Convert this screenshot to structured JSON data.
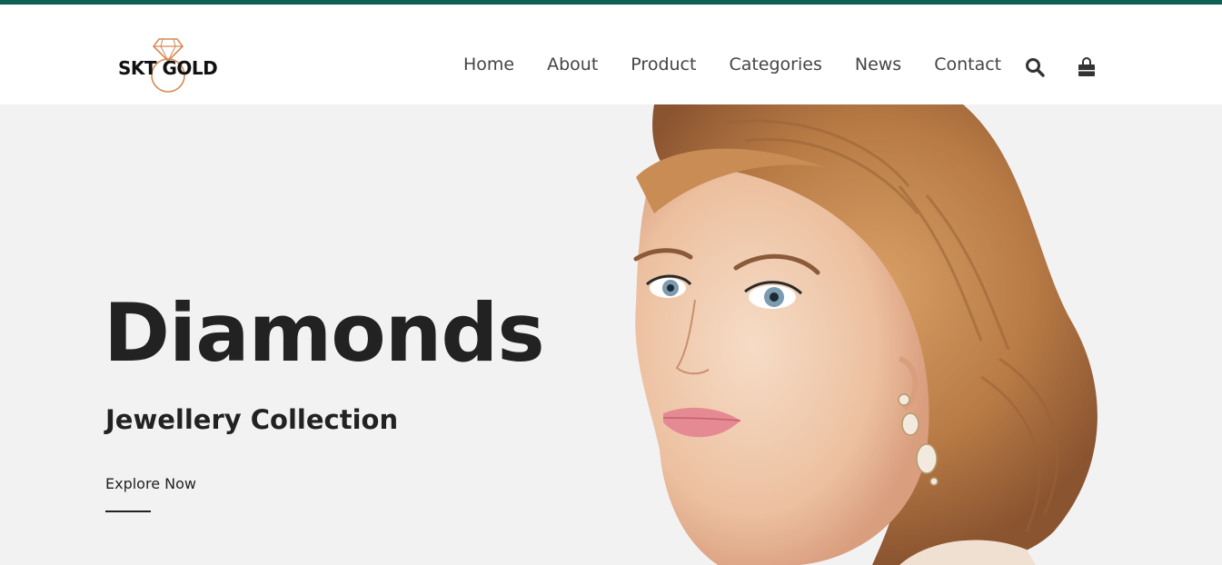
{
  "brand": {
    "name": "SKT GOLD",
    "accent_color": "#d58a55",
    "topbar_color": "#0f5f55"
  },
  "nav": {
    "items": [
      {
        "label": "Home"
      },
      {
        "label": "About"
      },
      {
        "label": "Product"
      },
      {
        "label": "Categories"
      },
      {
        "label": "News"
      },
      {
        "label": "Contact"
      }
    ],
    "icons": [
      "search-icon",
      "shopping-bag-icon"
    ]
  },
  "hero": {
    "title": "Diamonds",
    "subtitle": "Jewellery Collection",
    "cta": "Explore Now",
    "background": "#f2f2f2",
    "image": "woman-with-braided-hair-and-earrings"
  }
}
